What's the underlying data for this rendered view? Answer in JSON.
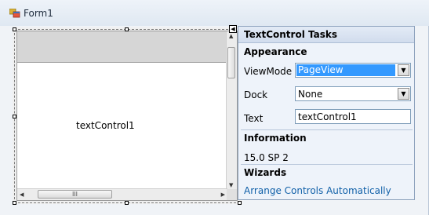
{
  "window": {
    "title": "Form1",
    "icon": "form-icon"
  },
  "text_control": {
    "label": "textControl1",
    "hscroll_grip": "III"
  },
  "smart_tag": {
    "glyph": "◀"
  },
  "tasks_panel": {
    "title": "TextControl Tasks",
    "appearance": {
      "heading": "Appearance",
      "view_mode": {
        "label": "ViewMode",
        "value": "PageView"
      },
      "dock": {
        "label": "Dock",
        "value": "None"
      },
      "text": {
        "label": "Text",
        "value": "textControl1"
      }
    },
    "information": {
      "heading": "Information",
      "value": "15.0 SP 2"
    },
    "wizards": {
      "heading": "Wizards",
      "link": "Arrange Controls Automatically"
    }
  },
  "colors": {
    "selection": "#3399ff",
    "link": "#1060a8",
    "panel_bg": "#eef3fa"
  }
}
